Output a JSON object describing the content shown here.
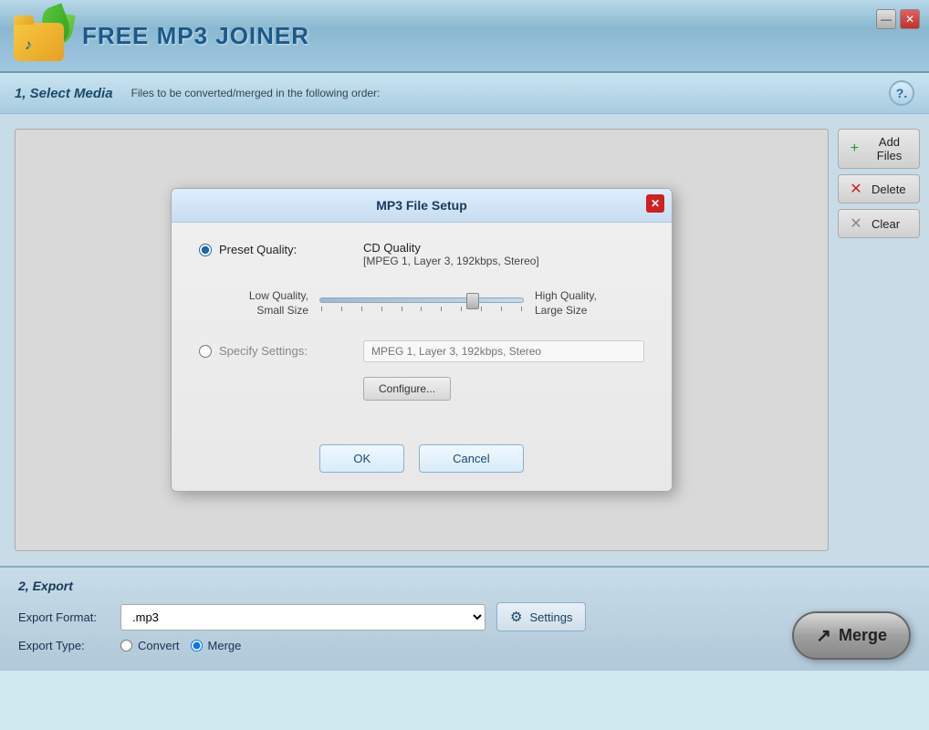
{
  "app": {
    "title": "FREE MP3 JOINER"
  },
  "title_controls": {
    "minimize": "—",
    "close": "✕"
  },
  "section1": {
    "title": "1, Select Media",
    "description": "Files to be converted/merged in the following order:",
    "help": "?."
  },
  "sidebar_buttons": {
    "add_files": "Add Files",
    "delete": "Delete",
    "clear": "Clear"
  },
  "modal": {
    "title": "MP3 File Setup",
    "close": "✕",
    "preset_quality_label": "Preset Quality:",
    "preset_name": "CD Quality",
    "preset_detail": "[MPEG 1, Layer 3, 192kbps, Stereo]",
    "slider_left_label": "Low Quality,\nSmall Size",
    "slider_right_label": "High Quality,\nLarge Size",
    "specify_settings_label": "Specify Settings:",
    "specify_placeholder": "MPEG 1, Layer 3, 192kbps, Stereo",
    "configure_btn": "Configure...",
    "ok_btn": "OK",
    "cancel_btn": "Cancel"
  },
  "export": {
    "title": "2, Export",
    "format_label": "Export Format:",
    "format_value": ".mp3",
    "settings_btn": "Settings",
    "type_label": "Export Type:",
    "convert_label": "Convert",
    "merge_label": "Merge",
    "merge_btn": "Merge"
  },
  "icons": {
    "add": "+",
    "delete": "✕",
    "clear": "✕",
    "gear": "⚙",
    "merge_arrow": "↗"
  }
}
